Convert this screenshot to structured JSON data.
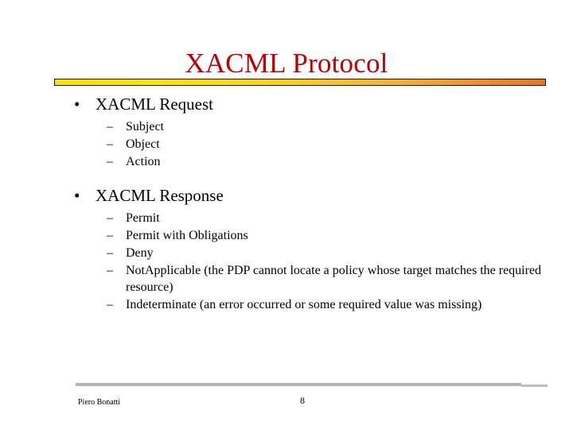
{
  "slide": {
    "title": "XACML Protocol",
    "title_color": "#c00000",
    "background_color": "#ffffff",
    "rule_gradient_start": "#ffe000",
    "rule_gradient_end": "#e9741c",
    "footer_rule_color": "#b3b3b3",
    "bullet_glyph": "•",
    "dash_glyph": "–"
  },
  "content": {
    "groups": [
      {
        "heading": "XACML Request",
        "items": [
          "Subject",
          "Object",
          "Action"
        ]
      },
      {
        "heading": "XACML Response",
        "items": [
          "Permit",
          "Permit with Obligations",
          "Deny",
          "NotApplicable (the PDP cannot locate a policy whose target matches the required resource)",
          "Indeterminate (an error occurred or some required value was missing)"
        ]
      }
    ]
  },
  "footer": {
    "author": "Piero Bonatti",
    "page_number": "8"
  }
}
